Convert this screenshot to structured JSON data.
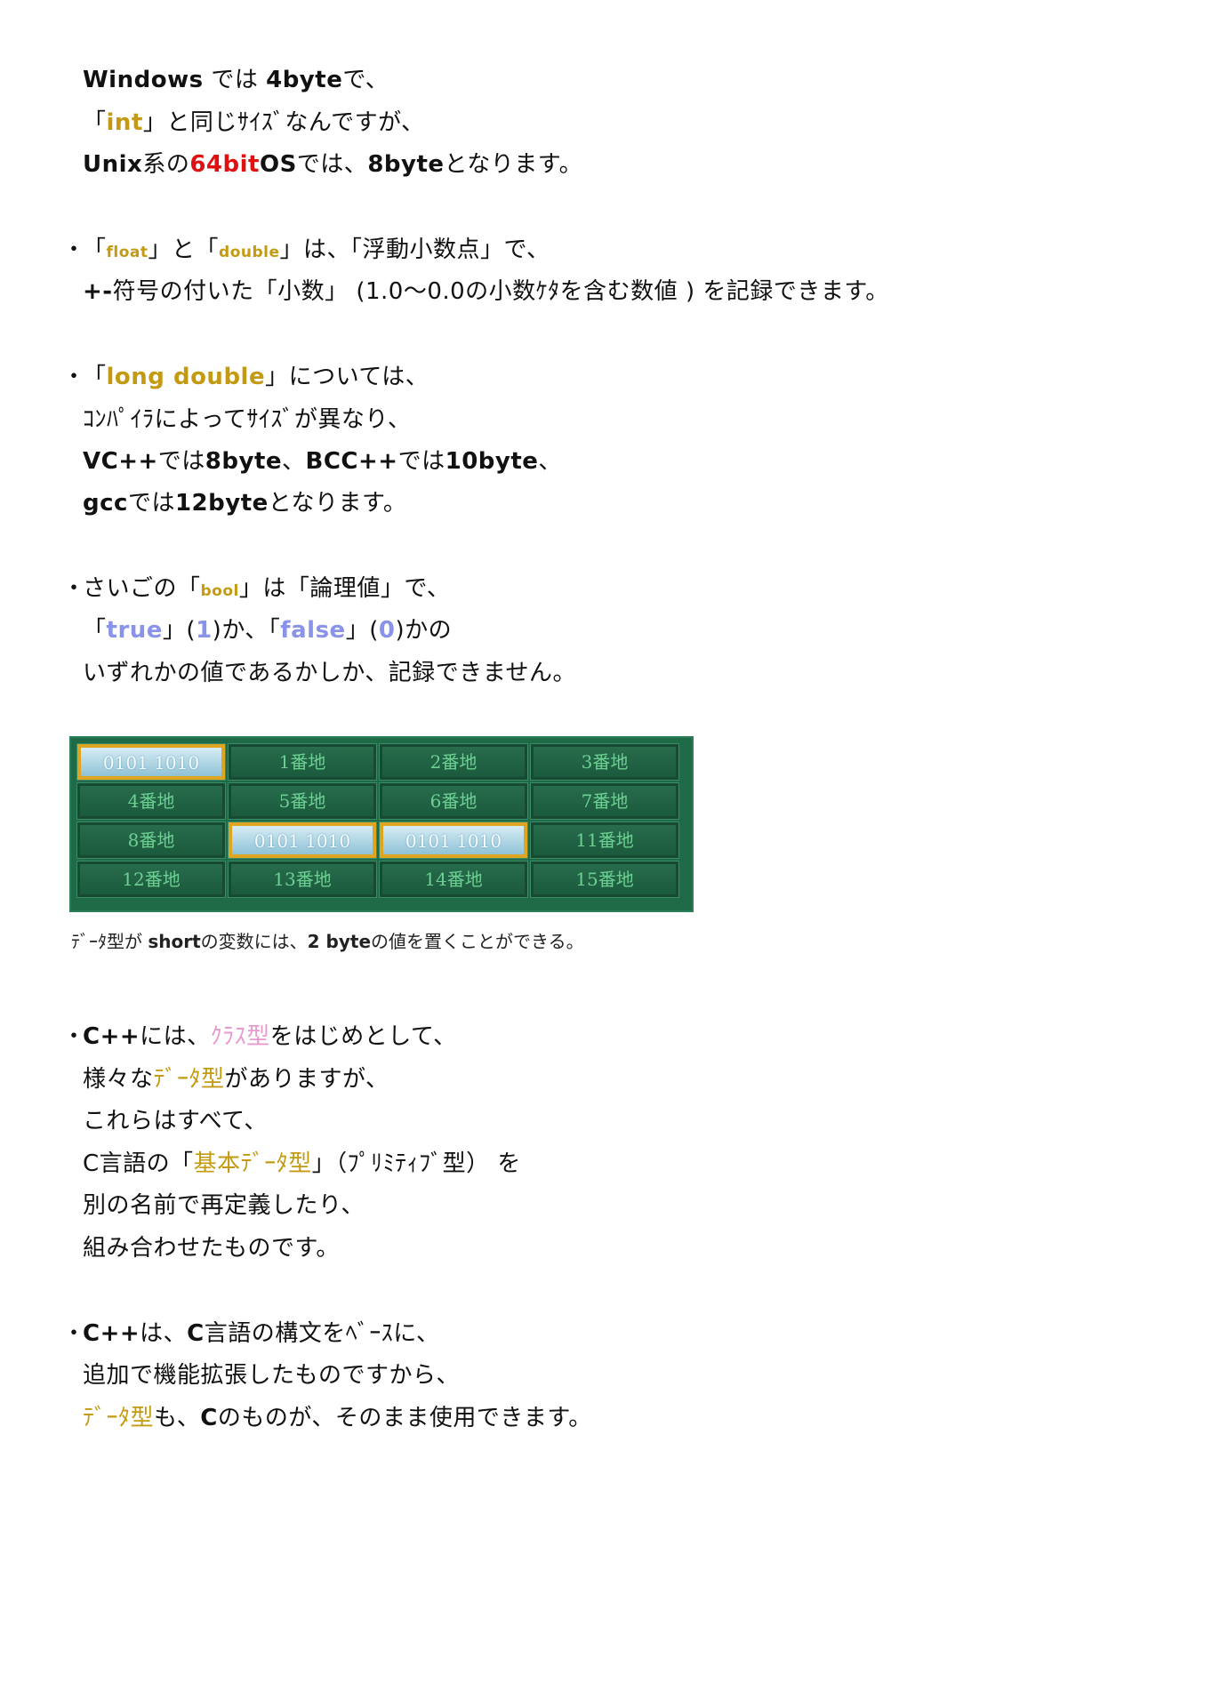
{
  "lines": [
    {
      "parts": [
        "Windows",
        " では ",
        "4byte",
        "で、"
      ]
    },
    {
      "parts": [
        "「",
        "int",
        "」と同じｻｲｽﾞなんですが、"
      ]
    },
    {
      "parts": [
        "Unix",
        "系の",
        "64bit",
        "OS",
        "では、",
        "8byte",
        "となります。"
      ]
    },
    {
      "parts": [
        "「",
        "float",
        "」と「",
        "double",
        "」は、「浮動小数点」で、"
      ]
    },
    {
      "parts": [
        "+-",
        "符号の付いた「小数」 (1.0〜0.0の小数ｹﾀを含む数値 ) を記録できます。"
      ]
    },
    {
      "parts": [
        "「",
        "long double",
        "」については、"
      ]
    },
    {
      "parts": [
        "ｺﾝﾊﾟｲﾗによってｻｲｽﾞが異なり、"
      ]
    },
    {
      "parts": [
        "VC++",
        "では",
        "8byte",
        "、",
        "BCC++",
        "では",
        "10byte",
        "、"
      ]
    },
    {
      "parts": [
        "gcc",
        "では",
        "12byte",
        "となります。"
      ]
    },
    {
      "parts": [
        "さいごの「",
        "bool",
        "」は「論理値」で、"
      ]
    },
    {
      "parts": [
        "「",
        "true",
        "」(",
        "1",
        ")か、「",
        "false",
        "」(",
        "0",
        ")かの"
      ]
    },
    {
      "parts": [
        "いずれかの値であるかしか、記録できません。"
      ]
    },
    {
      "parts": [
        "C++",
        "には、",
        "ｸﾗｽ型",
        "をはじめとして、"
      ]
    },
    {
      "parts": [
        "様々な",
        "ﾃﾞｰﾀ型",
        "がありますが、"
      ]
    },
    {
      "parts": [
        "これらはすべて、"
      ]
    },
    {
      "parts": [
        "C言語の「",
        "基本ﾃﾞｰﾀ型",
        "」（ﾌﾟﾘﾐﾃｨﾌﾞ型） を"
      ]
    },
    {
      "parts": [
        "別の名前で再定義したり、"
      ]
    },
    {
      "parts": [
        "組み合わせたものです。"
      ]
    },
    {
      "parts": [
        "C++",
        "は、",
        "C",
        "言語の構文をﾍﾞｰｽに、"
      ]
    },
    {
      "parts": [
        "追加で機能拡張したものですから、"
      ]
    },
    {
      "parts": [
        "ﾃﾞｰﾀ型",
        "も、",
        "C",
        "のものが、そのまま使用できます。"
      ]
    }
  ],
  "bullet": "・",
  "memory_grid": {
    "cells": [
      "0101 1010",
      "1番地",
      "2番地",
      "3番地",
      "4番地",
      "5番地",
      "6番地",
      "7番地",
      "8番地",
      "0101 1010",
      "0101 1010",
      "11番地",
      "12番地",
      "13番地",
      "14番地",
      "15番地"
    ],
    "highlighted": [
      0,
      9,
      10
    ]
  },
  "caption": {
    "parts": [
      "ﾃﾞｰﾀ型が ",
      "short",
      "の変数には、",
      "2 byte",
      "の値を置くことができる。"
    ]
  }
}
